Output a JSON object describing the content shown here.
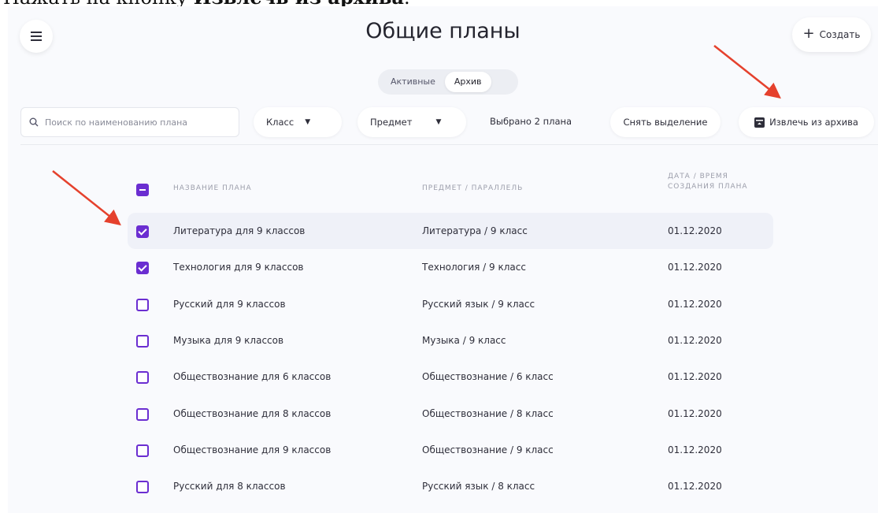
{
  "caption": {
    "prefix": "Нажать на кнопку ",
    "bold": "Извлечь из архива",
    "suffix": "."
  },
  "header": {
    "title": "Общие планы",
    "create_label": "Создать"
  },
  "tabs": [
    {
      "label": "Активные",
      "active": false
    },
    {
      "label": "Архив",
      "active": true
    }
  ],
  "toolbar": {
    "search_placeholder": "Поиск по наименованию плана",
    "class_filter": "Класс",
    "subject_filter": "Предмет",
    "selected_count": "Выбрано 2 плана",
    "deselect_label": "Снять выделение",
    "unarchive_label": "Извлечь из архива"
  },
  "table": {
    "headers": {
      "name": "НАЗВАНИЕ ПЛАНА",
      "subject": "ПРЕДМЕТ / ПАРАЛЛЕЛЬ",
      "date_line1": "ДАТА / ВРЕМЯ",
      "date_line2": "СОЗДАНИЯ ПЛАНА"
    },
    "rows": [
      {
        "name": "Литература для 9 классов",
        "subject": "Литература / 9 класс",
        "date": "01.12.2020",
        "checked": true
      },
      {
        "name": "Технология для 9 классов",
        "subject": "Технология / 9 класс",
        "date": "01.12.2020",
        "checked": true
      },
      {
        "name": "Русский для 9 классов",
        "subject": "Русский язык / 9 класс",
        "date": "01.12.2020",
        "checked": false
      },
      {
        "name": "Музыка для 9 классов",
        "subject": "Музыка / 9 класс",
        "date": "01.12.2020",
        "checked": false
      },
      {
        "name": "Обществознание для 6 классов",
        "subject": "Обществознание / 6 класс",
        "date": "01.12.2020",
        "checked": false
      },
      {
        "name": "Обществознание для 8 классов",
        "subject": "Обществознание / 8 класс",
        "date": "01.12.2020",
        "checked": false
      },
      {
        "name": "Обществознание для 9 классов",
        "subject": "Обществознание / 9 класс",
        "date": "01.12.2020",
        "checked": false
      },
      {
        "name": "Русский для 8 классов",
        "subject": "Русский язык / 8 класс",
        "date": "01.12.2020",
        "checked": false
      }
    ]
  },
  "colors": {
    "accent": "#6b2ed1",
    "annotation_arrow": "#e5412d",
    "background": "#f9fafd"
  },
  "icons": [
    "menu-icon",
    "plus-icon",
    "search-icon",
    "caret-down-icon",
    "archive-box-icon",
    "checkbox-icon"
  ]
}
